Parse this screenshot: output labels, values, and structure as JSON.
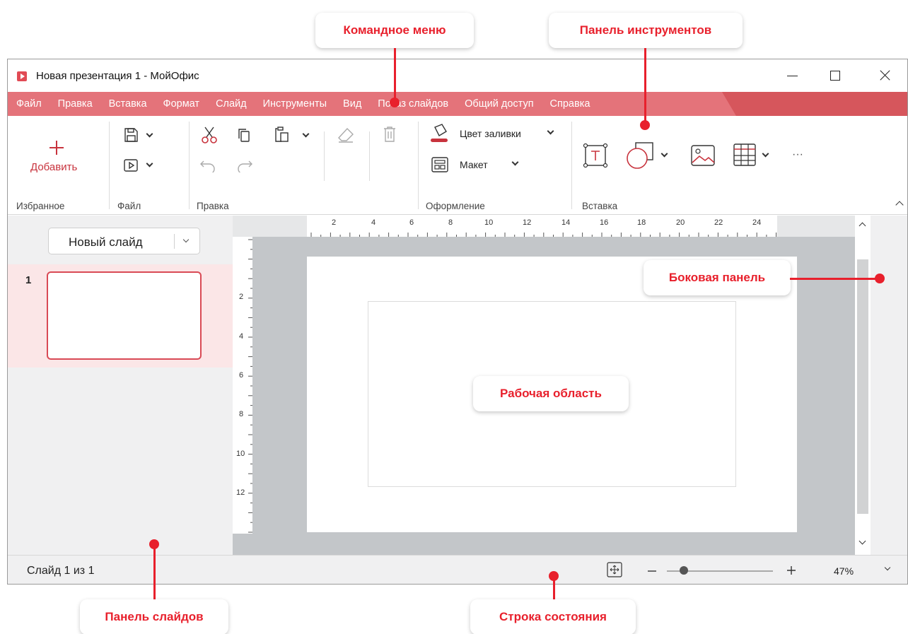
{
  "window": {
    "title": "Новая презентация 1 - МойОфис"
  },
  "menu": {
    "items": [
      "Файл",
      "Правка",
      "Вставка",
      "Формат",
      "Слайд",
      "Инструменты",
      "Вид",
      "Показ слайдов",
      "Общий доступ",
      "Справка"
    ]
  },
  "toolbar": {
    "groups": {
      "favorites": "Избранное",
      "file": "Файл",
      "edit": "Правка",
      "design": "Оформление",
      "insert": "Вставка"
    },
    "add_label": "Добавить",
    "fill_color_label": "Цвет заливки",
    "layout_label": "Макет",
    "more_label": "···"
  },
  "slides_panel": {
    "new_slide_label": "Новый слайд",
    "slide_number": "1"
  },
  "ruler": {
    "horizontal": [
      "2",
      "4",
      "6",
      "8",
      "10",
      "12",
      "14",
      "16",
      "18",
      "20",
      "22",
      "24"
    ],
    "vertical": [
      "2",
      "4",
      "6",
      "8",
      "10",
      "12"
    ]
  },
  "status": {
    "slide_info": "Слайд 1 из 1",
    "zoom": "47%",
    "zoom_level": 0.16
  },
  "callouts": {
    "command_menu": "Командное меню",
    "toolbar": "Панель инструментов",
    "side_panel": "Боковая панель",
    "work_area": "Рабочая область",
    "slides_panel": "Панель слайдов",
    "status_bar": "Строка состояния"
  },
  "colors": {
    "accent": "#d6565c",
    "callout": "#e8202c"
  }
}
